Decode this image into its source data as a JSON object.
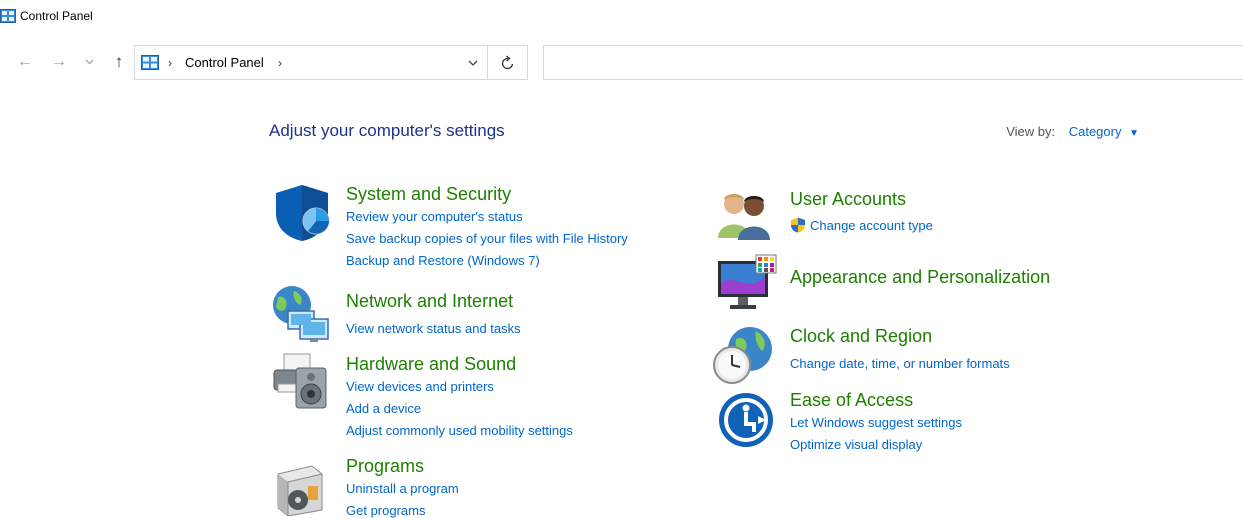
{
  "window": {
    "title": "Control Panel"
  },
  "nav": {
    "back_icon": "arrow-left",
    "forward_icon": "arrow-right",
    "recent_icon": "chevron-down",
    "up_icon": "arrow-up",
    "back_glyph": "←",
    "forward_glyph": "→",
    "recent_glyph": "⌄",
    "up_glyph": "↑"
  },
  "address": {
    "separator": "›",
    "crumb": "Control Panel",
    "dropdown_glyph": "⌄",
    "refresh_glyph": "↻"
  },
  "search": {
    "placeholder": ""
  },
  "main": {
    "heading": "Adjust your computer's settings",
    "view_by_label": "View by:",
    "view_by_value": "Category",
    "view_by_arrow": "▼"
  },
  "categories_left": [
    {
      "title": "System and Security",
      "icon": "shield-icon",
      "links": [
        "Review your computer's status",
        "Save backup copies of your files with File History",
        "Backup and Restore (Windows 7)"
      ]
    },
    {
      "title": "Network and Internet",
      "icon": "network-globe-icon",
      "links": [
        "View network status and tasks"
      ]
    },
    {
      "title": "Hardware and Sound",
      "icon": "printer-speaker-icon",
      "links": [
        "View devices and printers",
        "Add a device",
        "Adjust commonly used mobility settings"
      ]
    },
    {
      "title": "Programs",
      "icon": "programs-box-icon",
      "links": [
        "Uninstall a program",
        "Get programs"
      ]
    }
  ],
  "categories_right": [
    {
      "title": "User Accounts",
      "icon": "users-icon",
      "links": [
        "Change account type"
      ]
    },
    {
      "title": "Appearance and Personalization",
      "icon": "monitor-colors-icon",
      "links": []
    },
    {
      "title": "Clock and Region",
      "icon": "clock-globe-icon",
      "links": [
        "Change date, time, or number formats"
      ]
    },
    {
      "title": "Ease of Access",
      "icon": "ease-of-access-icon",
      "links": [
        "Let Windows suggest settings",
        "Optimize visual display"
      ]
    }
  ],
  "colors": {
    "category_title": "#1e8000",
    "link": "#0066cc",
    "heading": "#1e3287"
  }
}
